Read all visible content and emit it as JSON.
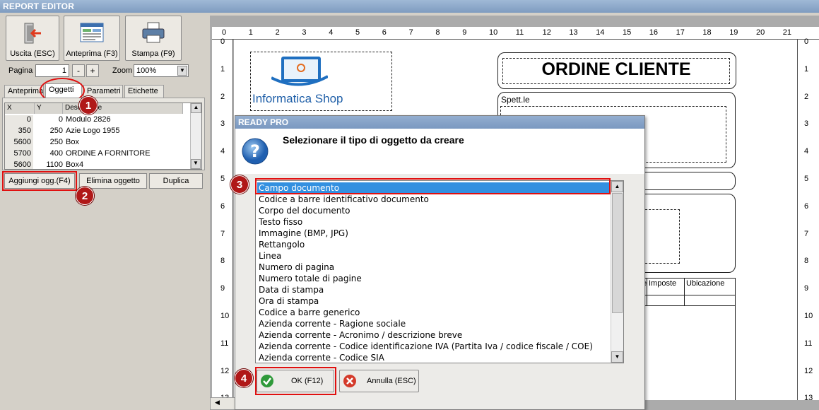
{
  "window_title": "REPORT EDITOR",
  "toolbar": {
    "exit_label": "Uscita (ESC)",
    "preview_label": "Anteprima (F3)",
    "print_label": "Stampa (F9)"
  },
  "page_label": "Pagina",
  "page_value": "1",
  "minus": "-",
  "plus": "+",
  "zoom_label": "Zoom",
  "zoom_value": "100%",
  "tabs": [
    "Anteprima",
    "Oggetti",
    "Parametri",
    "Etichette"
  ],
  "grid": {
    "headers": [
      "X",
      "Y",
      "Descrizione"
    ],
    "rows": [
      [
        "0",
        "0",
        "Modulo 2826"
      ],
      [
        "350",
        "250",
        "Azie Logo 1955"
      ],
      [
        "5600",
        "250",
        "Box"
      ],
      [
        "5700",
        "400",
        "ORDINE A FORNITORE"
      ],
      [
        "5600",
        "1100",
        "Box4"
      ]
    ]
  },
  "buttons": {
    "add": "Aggiungi ogg.(F4)",
    "delete": "Elimina oggetto",
    "duplicate": "Duplica"
  },
  "badges": [
    "1",
    "2",
    "3",
    "4"
  ],
  "ruler_top": [
    "0",
    "1",
    "2",
    "3",
    "4",
    "5",
    "6",
    "7",
    "8",
    "9",
    "10",
    "11",
    "12",
    "13",
    "14",
    "15",
    "16",
    "17",
    "18",
    "19",
    "20",
    "21"
  ],
  "ruler_side": [
    "0",
    "1",
    "2",
    "3",
    "4",
    "5",
    "6",
    "7",
    "8",
    "9",
    "10",
    "11",
    "12",
    "13"
  ],
  "document": {
    "title": "ORDINE CLIENTE",
    "logo_text": "Informatica Shop",
    "spett": "Spett.le",
    "col_imposte": "Imposte",
    "col_ubicazione": "Ubicazione",
    "col_partial": "e"
  },
  "dialog": {
    "title": "READY PRO",
    "question": "Selezionare il tipo di oggetto da creare",
    "items": [
      "Campo documento",
      "Codice a barre identificativo documento",
      "Corpo del documento",
      "Testo fisso",
      "Immagine (BMP, JPG)",
      "Rettangolo",
      "Linea",
      "Numero di pagina",
      "Numero totale di pagine",
      "Data di stampa",
      "Ora di stampa",
      "Codice a barre generico",
      "Azienda corrente - Ragione sociale",
      "Azienda corrente - Acronimo / descrizione breve",
      "Azienda corrente - Codice identificazione IVA (Partita Iva / codice fiscale / COE)",
      "Azienda corrente - Codice SIA"
    ],
    "ok_label": "OK (F12)",
    "cancel_label": "Annulla (ESC)"
  },
  "colors": {
    "accent": "#3390e0",
    "highlight": "#e01010",
    "badge": "#b01818"
  }
}
